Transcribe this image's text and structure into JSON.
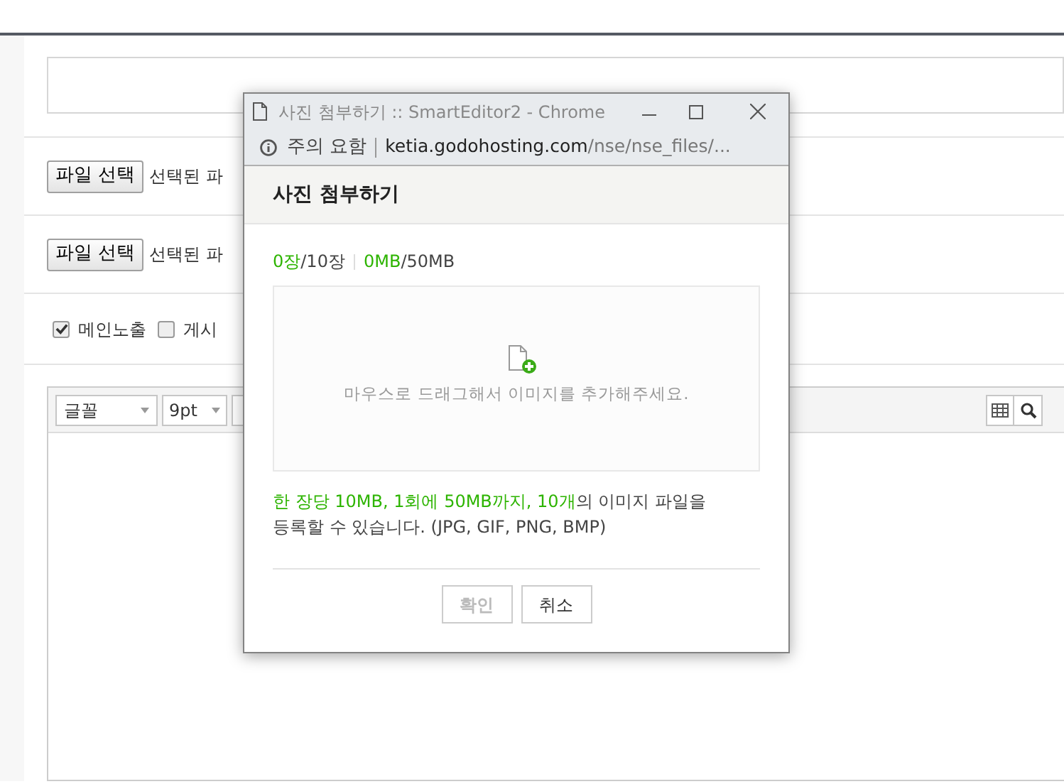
{
  "page": {
    "file_rows": [
      {
        "button": "파일 선택",
        "status": "선택된 파"
      },
      {
        "button": "파일 선택",
        "status": "선택된 파"
      }
    ],
    "options": [
      {
        "label": "메인노출",
        "checked": true
      },
      {
        "label": "게시",
        "checked": false
      }
    ],
    "editor": {
      "font_select": "글꼴",
      "size_select": "9pt"
    }
  },
  "popup": {
    "window_title": "사진 첨부하기 :: SmartEditor2 - Chrome",
    "security": "주의 요함",
    "url_host": "ketia.godohosting.com",
    "url_path": "/nse/nse_files/...",
    "heading": "사진 첨부하기",
    "counter": [
      {
        "text": "0장",
        "highlight": true
      },
      {
        "text": "/10장",
        "highlight": false
      },
      {
        "text": "0MB",
        "highlight": true
      },
      {
        "text": "/50MB",
        "highlight": false
      }
    ],
    "drop_hint": "마우스로 드래그해서 이미지를 추가해주세요.",
    "notice": [
      {
        "text": "한 장당 10MB, 1회에 50MB까지, 10개",
        "highlight": true
      },
      {
        "text": "의 이미지 파일을 등록할 수 있습니다. (JPG, GIF, PNG, BMP)",
        "highlight": false
      }
    ],
    "buttons": [
      {
        "label": "확인",
        "disabled": true
      },
      {
        "label": "취소",
        "disabled": false
      }
    ]
  }
}
